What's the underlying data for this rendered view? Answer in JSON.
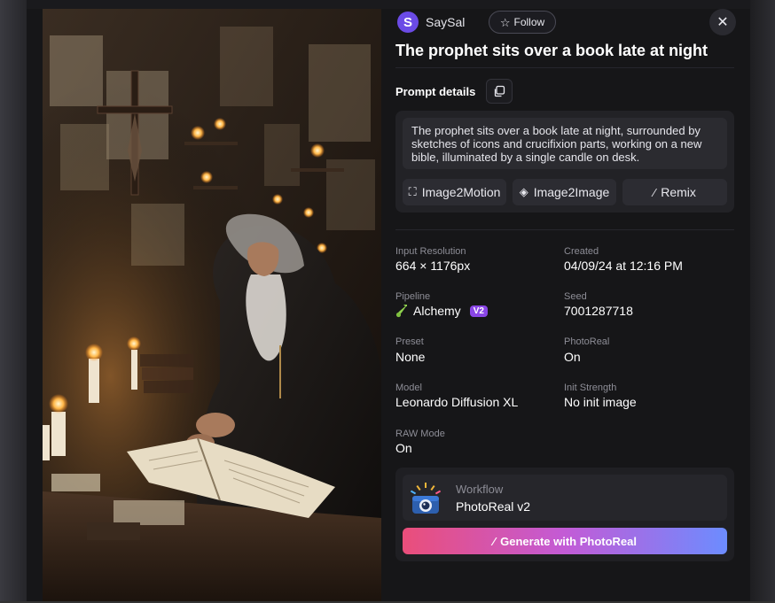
{
  "header": {
    "avatar_letter": "S",
    "username": "SaySal",
    "follow_label": "Follow",
    "close_label": "✕"
  },
  "title": "The prophet sits over a book late at night",
  "prompt": {
    "label": "Prompt details",
    "text": "The prophet sits over a book late at night, surrounded by sketches of icons and crucifixion parts, working on a new bible, illuminated by a single candle on desk."
  },
  "actions": [
    {
      "label": "Image2Motion",
      "icon": "motion-icon"
    },
    {
      "label": "Image2Image",
      "icon": "layers-icon"
    },
    {
      "label": "Remix",
      "icon": "magic-wand-icon"
    }
  ],
  "details": {
    "input_resolution": {
      "label": "Input Resolution",
      "value": "664 × 1176px"
    },
    "created": {
      "label": "Created",
      "value": "04/09/24 at 12:16 PM"
    },
    "pipeline": {
      "label": "Pipeline",
      "value": "Alchemy",
      "badge": "V2"
    },
    "seed": {
      "label": "Seed",
      "value": "7001287718"
    },
    "preset": {
      "label": "Preset",
      "value": "None"
    },
    "photoreal": {
      "label": "PhotoReal",
      "value": "On"
    },
    "model": {
      "label": "Model",
      "value": "Leonardo Diffusion XL"
    },
    "init_strength": {
      "label": "Init Strength",
      "value": "No init image"
    },
    "raw_mode": {
      "label": "RAW Mode",
      "value": "On"
    }
  },
  "workflow": {
    "label": "Workflow",
    "value": "PhotoReal v2",
    "generate_label": "Generate with PhotoReal"
  },
  "colors": {
    "accent_purple": "#8a46e6",
    "avatar": "#6b4be6",
    "generate_gradient_start": "#ea4e7a",
    "generate_gradient_end": "#6c8cff"
  }
}
